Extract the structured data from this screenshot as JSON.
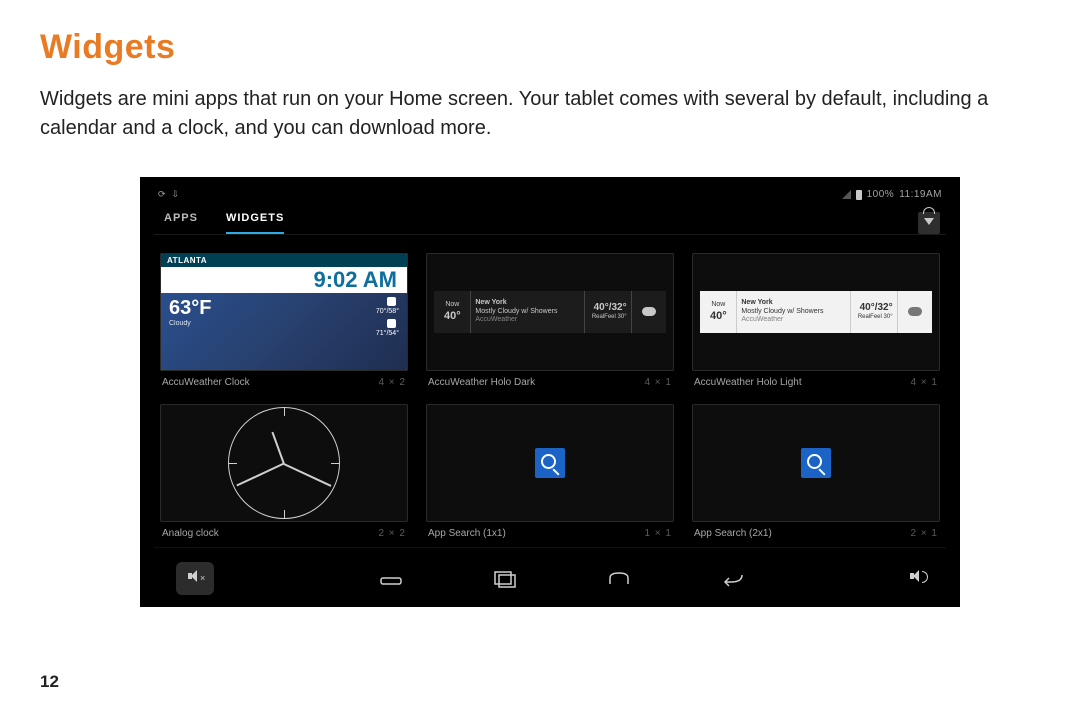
{
  "doc": {
    "title": "Widgets",
    "intro": "Widgets are mini apps that run on your Home screen. Your tablet comes with several by default, including a calendar and a clock, and you can download more.",
    "page_number": "12"
  },
  "status": {
    "battery": "100%",
    "time": "11:19AM"
  },
  "tabs": {
    "apps": "APPS",
    "widgets": "WIDGETS"
  },
  "widgets": [
    {
      "name": "AccuWeather Clock",
      "dim": "4 × 2"
    },
    {
      "name": "AccuWeather Holo Dark",
      "dim": "4 × 1"
    },
    {
      "name": "AccuWeather Holo Light",
      "dim": "4 × 1"
    },
    {
      "name": "Analog clock",
      "dim": "2 × 2"
    },
    {
      "name": "App Search (1x1)",
      "dim": "1 × 1"
    },
    {
      "name": "App Search (2x1)",
      "dim": "2 × 1"
    }
  ],
  "accu_clock": {
    "city": "ATLANTA",
    "time": "9:02 AM",
    "temp": "63°F",
    "cond": "Cloudy",
    "row1": "70°/58°",
    "row2": "71°/54°"
  },
  "holo": {
    "left_label": "Now",
    "city": "New York",
    "cond": "Mostly Cloudy w/ Showers",
    "brand": "AccuWeather",
    "big_temp": "40°",
    "hi_lo": "40°/32°",
    "real": "RealFeel 30°"
  }
}
